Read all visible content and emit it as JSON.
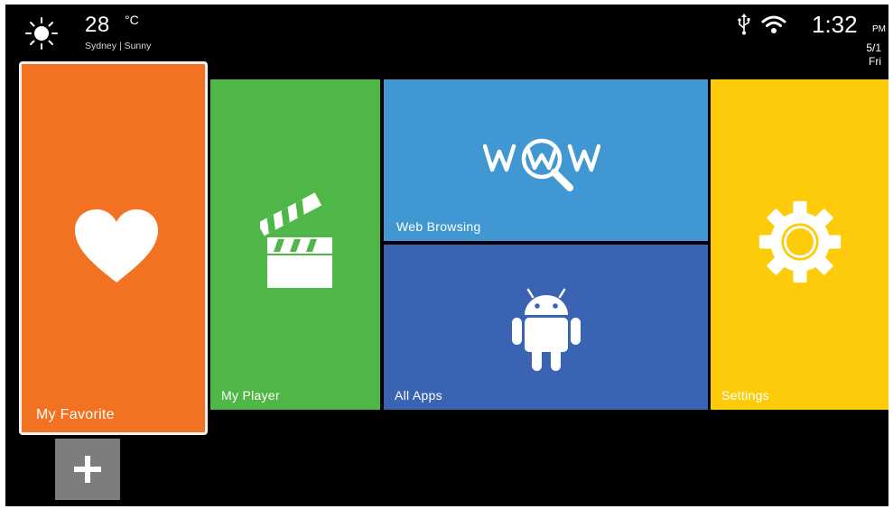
{
  "status_bar": {
    "weather_icon": "sun-icon",
    "temperature": "28",
    "temperature_unit": "°C",
    "location": "Sydney | Sunny",
    "usb_icon": "usb-icon",
    "wifi_icon": "wifi-icon",
    "time": "1:32",
    "ampm": "PM",
    "date": "5/1",
    "weekday": "Fri"
  },
  "tiles": {
    "favorite": {
      "label": "My Favorite",
      "icon": "heart-icon",
      "color": "#f37221"
    },
    "player": {
      "label": "My Player",
      "icon": "clapperboard-icon",
      "color": "#4fb748"
    },
    "web": {
      "label": "Web Browsing",
      "icon": "www-search-icon",
      "color": "#4097d1"
    },
    "apps": {
      "label": "All Apps",
      "icon": "android-icon",
      "color": "#3a64b1"
    },
    "settings": {
      "label": "Settings",
      "icon": "gear-icon",
      "color": "#fecb0a"
    }
  },
  "add_button": {
    "icon": "plus-icon"
  }
}
